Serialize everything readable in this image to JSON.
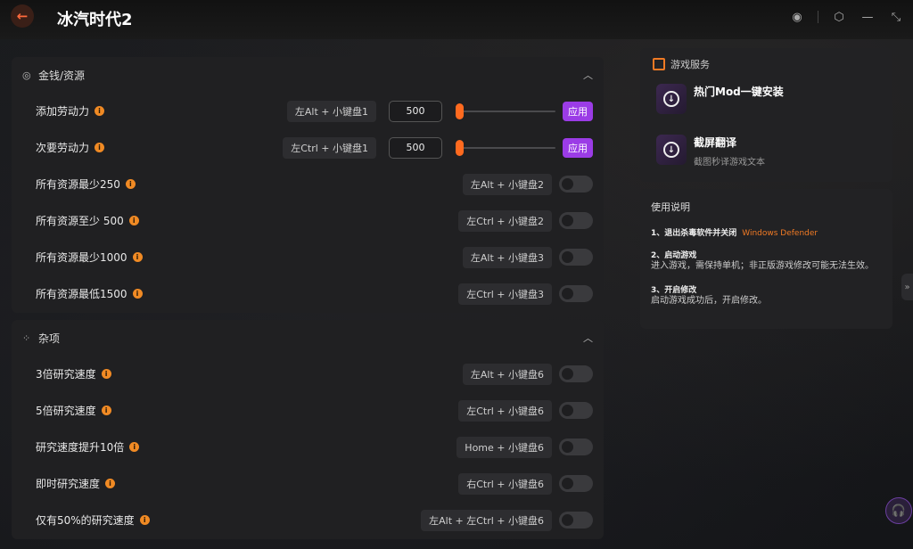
{
  "app": {
    "title": "冰汽时代2"
  },
  "panels": [
    {
      "title": "金钱/资源",
      "rows": [
        {
          "label": "添加劳动力",
          "hotkey": "左Alt + 小键盘1",
          "value": "500",
          "apply_label": "应用",
          "slider": 0.0
        },
        {
          "label": "次要劳动力",
          "hotkey": "左Ctrl + 小键盘1",
          "value": "500",
          "apply_label": "应用",
          "slider": 0.0
        },
        {
          "label": "所有资源最少250",
          "hotkey": "左Alt + 小键盘2"
        },
        {
          "label": "所有资源至少 500",
          "hotkey": "左Ctrl + 小键盘2"
        },
        {
          "label": "所有资源最少1000",
          "hotkey": "左Alt + 小键盘3"
        },
        {
          "label": "所有资源最低1500",
          "hotkey": "左Ctrl + 小键盘3"
        }
      ]
    },
    {
      "title": "杂项",
      "rows": [
        {
          "label": "3倍研究速度",
          "hotkey": "左Alt + 小键盘6"
        },
        {
          "label": "5倍研究速度",
          "hotkey": "左Ctrl + 小键盘6"
        },
        {
          "label": "研究速度提升10倍",
          "hotkey": "Home + 小键盘6"
        },
        {
          "label": "即时研究速度",
          "hotkey": "右Ctrl + 小键盘6"
        },
        {
          "label": "仅有50%的研究速度",
          "hotkey": "左Alt + 左Ctrl + 小键盘6"
        }
      ]
    }
  ],
  "service": {
    "title": "游戏服务",
    "items": [
      {
        "title": "热门Mod一键安装",
        "subtitle": ""
      },
      {
        "title": "截屏翻译",
        "subtitle": "截图秒译游戏文本"
      }
    ]
  },
  "help": {
    "title": "使用说明",
    "steps": [
      {
        "title": "1、退出杀毒软件并关闭",
        "highlight": "Windows Defender",
        "text": ""
      },
      {
        "title": "2、启动游戏",
        "text": "进入游戏，需保持单机；非正版游戏修改可能无法生效。"
      },
      {
        "title": "3、开启修改",
        "text": "启动游戏成功后，开启修改。"
      }
    ]
  },
  "colors": {
    "accent": "#ff6a1f",
    "apply": "#9b3ce6",
    "info": "#f08a24"
  }
}
